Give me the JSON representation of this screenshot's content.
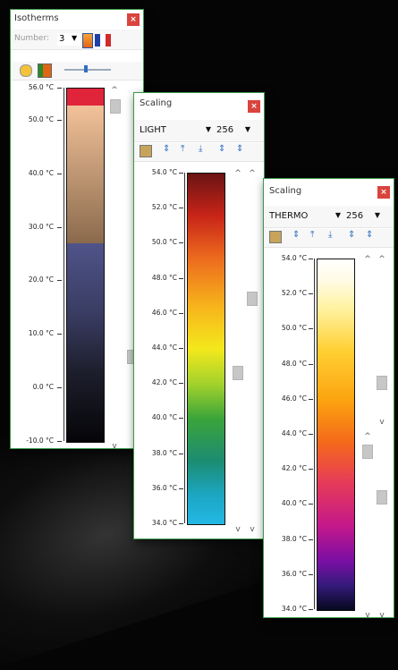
{
  "colors": {
    "accent_border": "#3a9a4a",
    "close_button": "#d9443d"
  },
  "isotherms": {
    "title": "Isotherms",
    "close_label": "×",
    "number_label": "Number:",
    "number_value": "3",
    "icons": [
      "palette-icon",
      "flag-icon",
      "face-icon",
      "layout-icon",
      "slider-icon"
    ],
    "ticks": [
      "56.0 °C",
      "50.0 °C",
      "40.0 °C",
      "30.0 °C",
      "20.0 °C",
      "10.0 °C",
      "0.0 °C",
      "-10.0 °C"
    ],
    "bands": [
      {
        "color": "#e0253a",
        "from": 56.0,
        "to": 52.8
      },
      {
        "color": "gradient-peach-to-brown",
        "from": 52.8,
        "to": 26.5
      },
      {
        "color": "gradient-slate-to-black",
        "from": 26.5,
        "to": -10.0
      }
    ],
    "arrows": [
      "^",
      "v"
    ]
  },
  "scaling_light": {
    "title": "Scaling",
    "close_label": "×",
    "palette": "LIGHT",
    "levels": "256",
    "ticks": [
      "54.0 °C",
      "52.0 °C",
      "50.0 °C",
      "48.0 °C",
      "46.0 °C",
      "44.0 °C",
      "42.0 °C",
      "40.0 °C",
      "38.0 °C",
      "36.0 °C",
      "34.0 °C"
    ],
    "arrows": [
      "^",
      "v",
      "^",
      "v"
    ]
  },
  "scaling_thermo": {
    "title": "Scaling",
    "close_label": "×",
    "palette": "THERMO",
    "levels": "256",
    "ticks": [
      "54.0 °C",
      "52.0 °C",
      "50.0 °C",
      "48.0 °C",
      "46.0 °C",
      "44.0 °C",
      "42.0 °C",
      "40.0 °C",
      "38.0 °C",
      "36.0 °C",
      "34.0 °C"
    ],
    "arrows": [
      "^",
      "^",
      "v",
      "^",
      "v",
      "v"
    ]
  }
}
